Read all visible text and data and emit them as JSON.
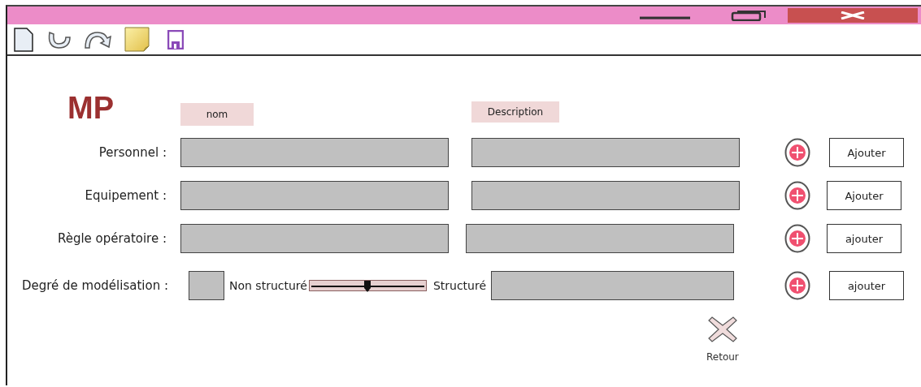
{
  "heading": "MP",
  "columns": [
    "nom",
    "Description"
  ],
  "rows": [
    {
      "kind": "text",
      "label": "Personnel :",
      "button": "Ajouter"
    },
    {
      "kind": "text",
      "label": "Equipement :",
      "button": "Ajouter"
    },
    {
      "kind": "text",
      "label": "Règle opératoire :",
      "button": "ajouter"
    },
    {
      "kind": "slider",
      "label": "Degré de modélisation :",
      "min_label": "Non structuré",
      "max_label": "Structuré",
      "level": 0.5,
      "button": "ajouter"
    }
  ],
  "back_button": "Retour"
}
